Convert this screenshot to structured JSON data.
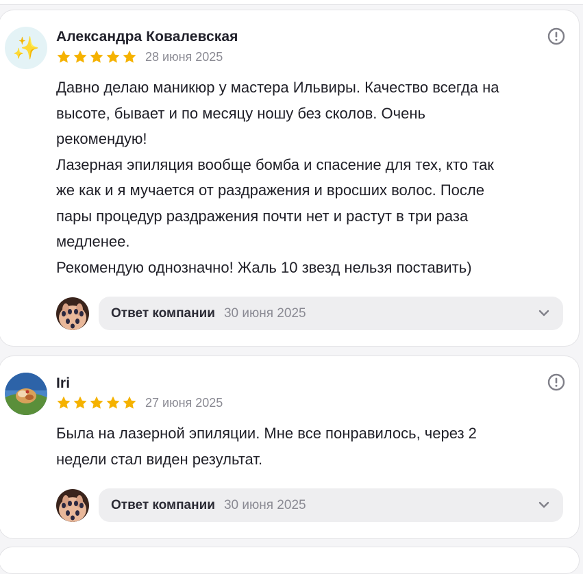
{
  "reviews": [
    {
      "author": "Александра Ковалевская",
      "avatar_icon": "sparkles-icon",
      "rating": 5,
      "date": "28 июня 2025",
      "text_lines": [
        "Давно делаю маникюр у мастера Ильвиры. Качество всегда на",
        "высоте, бывает и по месяцу ношу без сколов. Очень",
        "рекомендую!",
        "Лазерная эпиляция вообще бомба и спасение для тех, кто так",
        "же как и я мучается от раздражения и вросших волос. После",
        "пары процедур раздражения почти нет и растут в три раза",
        "медленее.",
        "Рекомендую однозначно! Жаль 10 звезд нельзя поставить)"
      ],
      "reply": {
        "label": "Ответ компании",
        "date": "30 июня 2025"
      }
    },
    {
      "author": "Iri",
      "avatar_icon": "landscape-photo-avatar",
      "rating": 5,
      "date": "27 июня 2025",
      "text_lines": [
        "Была на лазерной эпиляции. Мне все понравилось, через 2",
        "недели стал виден результат."
      ],
      "reply": {
        "label": "Ответ компании",
        "date": "30 июня 2025"
      }
    }
  ],
  "colors": {
    "star": "#f5b200",
    "report_icon": "#7f7f88",
    "reply_bar_bg": "#eeeef0"
  }
}
